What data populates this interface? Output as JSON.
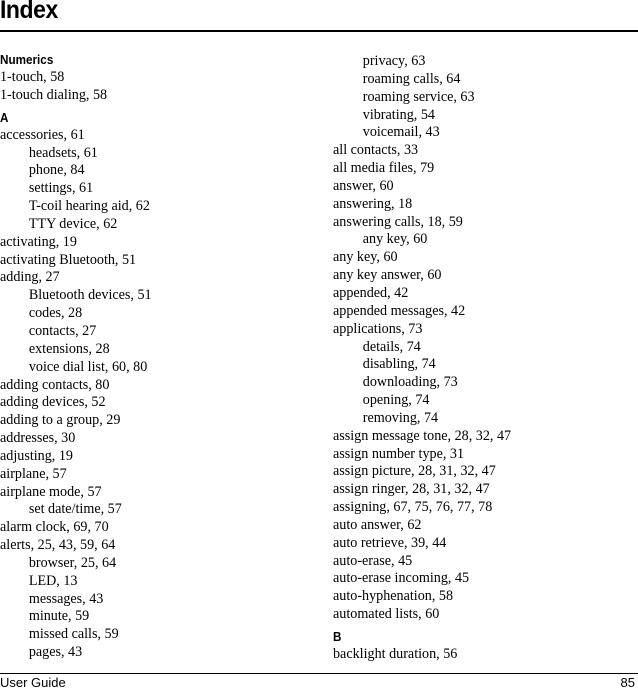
{
  "page": {
    "title": "Index",
    "footer_left": "User Guide",
    "footer_right": "85"
  },
  "left_column": [
    {
      "type": "heading",
      "text": "Numerics"
    },
    {
      "type": "entry",
      "text": "1-touch, 58"
    },
    {
      "type": "entry",
      "text": "1-touch dialing, 58"
    },
    {
      "type": "heading",
      "text": "A"
    },
    {
      "type": "entry",
      "text": "accessories, 61"
    },
    {
      "type": "sub",
      "text": "headsets, 61"
    },
    {
      "type": "sub",
      "text": "phone, 84"
    },
    {
      "type": "sub",
      "text": "settings, 61"
    },
    {
      "type": "sub",
      "text": "T-coil hearing aid, 62"
    },
    {
      "type": "sub",
      "text": "TTY device, 62"
    },
    {
      "type": "entry",
      "text": "activating, 19"
    },
    {
      "type": "entry",
      "text": "activating Bluetooth, 51"
    },
    {
      "type": "entry",
      "text": "adding, 27"
    },
    {
      "type": "sub",
      "text": "Bluetooth devices, 51"
    },
    {
      "type": "sub",
      "text": "codes, 28"
    },
    {
      "type": "sub",
      "text": "contacts, 27"
    },
    {
      "type": "sub",
      "text": "extensions, 28"
    },
    {
      "type": "sub",
      "text": "voice dial list, 60, 80"
    },
    {
      "type": "entry",
      "text": "adding contacts, 80"
    },
    {
      "type": "entry",
      "text": "adding devices, 52"
    },
    {
      "type": "entry",
      "text": "adding to a group, 29"
    },
    {
      "type": "entry",
      "text": "addresses, 30"
    },
    {
      "type": "entry",
      "text": "adjusting, 19"
    },
    {
      "type": "entry",
      "text": "airplane, 57"
    },
    {
      "type": "entry",
      "text": "airplane mode, 57"
    },
    {
      "type": "sub",
      "text": "set date/time, 57"
    },
    {
      "type": "entry",
      "text": "alarm clock, 69, 70"
    },
    {
      "type": "entry",
      "text": "alerts, 25, 43, 59, 64"
    },
    {
      "type": "sub",
      "text": "browser, 25, 64"
    },
    {
      "type": "sub",
      "text": "LED, 13"
    },
    {
      "type": "sub",
      "text": "messages, 43"
    },
    {
      "type": "sub",
      "text": "minute, 59"
    },
    {
      "type": "sub",
      "text": "missed calls, 59"
    },
    {
      "type": "sub",
      "text": "pages, 43"
    }
  ],
  "right_column": [
    {
      "type": "sub",
      "text": "privacy, 63"
    },
    {
      "type": "sub",
      "text": "roaming calls, 64"
    },
    {
      "type": "sub",
      "text": "roaming service, 63"
    },
    {
      "type": "sub",
      "text": "vibrating, 54"
    },
    {
      "type": "sub",
      "text": "voicemail, 43"
    },
    {
      "type": "entry",
      "text": "all contacts, 33"
    },
    {
      "type": "entry",
      "text": "all media files, 79"
    },
    {
      "type": "entry",
      "text": "answer, 60"
    },
    {
      "type": "entry",
      "text": "answering, 18"
    },
    {
      "type": "entry",
      "text": "answering calls, 18, 59"
    },
    {
      "type": "sub",
      "text": "any key, 60"
    },
    {
      "type": "entry",
      "text": "any key, 60"
    },
    {
      "type": "entry",
      "text": "any key answer, 60"
    },
    {
      "type": "entry",
      "text": "appended, 42"
    },
    {
      "type": "entry",
      "text": "appended messages, 42"
    },
    {
      "type": "entry",
      "text": "applications, 73"
    },
    {
      "type": "sub",
      "text": "details, 74"
    },
    {
      "type": "sub",
      "text": "disabling, 74"
    },
    {
      "type": "sub",
      "text": "downloading, 73"
    },
    {
      "type": "sub",
      "text": "opening, 74"
    },
    {
      "type": "sub",
      "text": "removing, 74"
    },
    {
      "type": "entry",
      "text": "assign message tone, 28, 32, 47"
    },
    {
      "type": "entry",
      "text": "assign number type, 31"
    },
    {
      "type": "entry",
      "text": "assign picture, 28, 31, 32, 47"
    },
    {
      "type": "entry",
      "text": "assign ringer, 28, 31, 32, 47"
    },
    {
      "type": "entry",
      "text": "assigning, 67, 75, 76, 77, 78"
    },
    {
      "type": "entry",
      "text": "auto answer, 62"
    },
    {
      "type": "entry",
      "text": "auto retrieve, 39, 44"
    },
    {
      "type": "entry",
      "text": "auto-erase, 45"
    },
    {
      "type": "entry",
      "text": "auto-erase incoming, 45"
    },
    {
      "type": "entry",
      "text": "auto-hyphenation, 58"
    },
    {
      "type": "entry",
      "text": "automated lists, 60"
    },
    {
      "type": "heading",
      "text": "B"
    },
    {
      "type": "entry",
      "text": "backlight duration, 56"
    }
  ]
}
